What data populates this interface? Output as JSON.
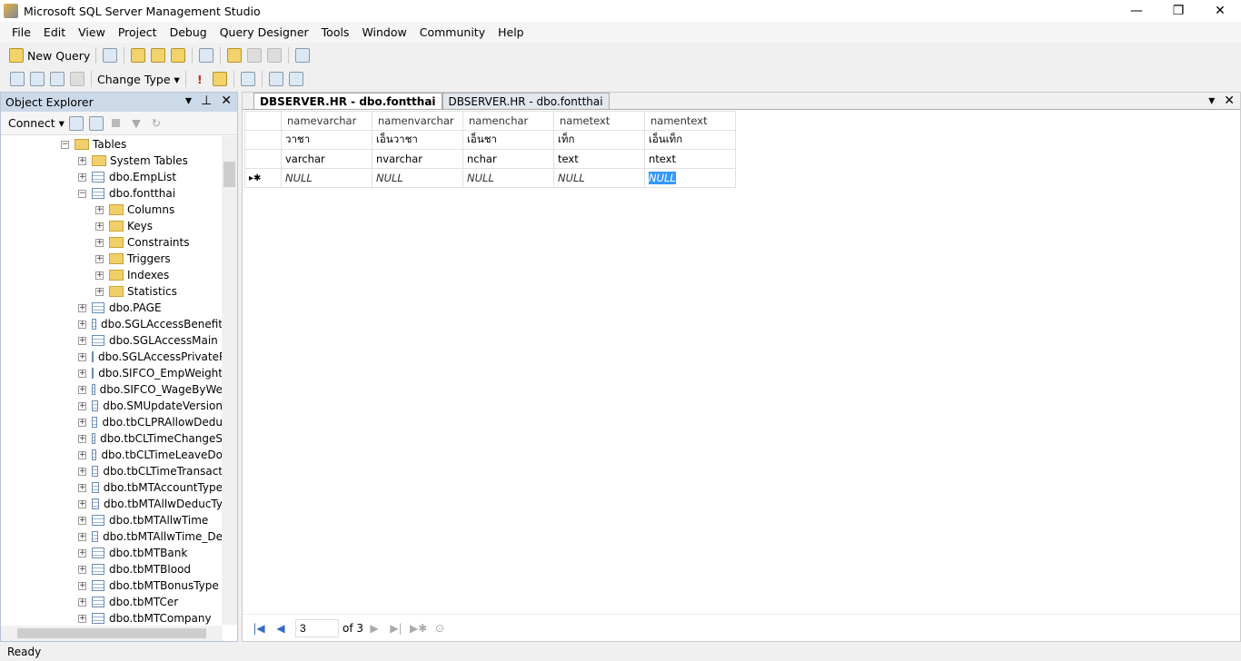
{
  "window": {
    "title": "Microsoft SQL Server Management Studio",
    "minimize": "—",
    "restore": "❐",
    "close": "✕"
  },
  "menu": [
    "File",
    "Edit",
    "View",
    "Project",
    "Debug",
    "Query Designer",
    "Tools",
    "Window",
    "Community",
    "Help"
  ],
  "toolbar": {
    "new_query": "New Query",
    "change_type": "Change Type ▾"
  },
  "object_explorer": {
    "title": "Object Explorer",
    "connect": "Connect ▾",
    "tree": [
      {
        "label": "Tables",
        "level": 0,
        "kind": "folder",
        "exp": "−"
      },
      {
        "label": "System Tables",
        "level": 1,
        "kind": "folder",
        "exp": "+"
      },
      {
        "label": "dbo.EmpList",
        "level": 1,
        "kind": "table",
        "exp": "+"
      },
      {
        "label": "dbo.fontthai",
        "level": 1,
        "kind": "table",
        "exp": "−"
      },
      {
        "label": "Columns",
        "level": 2,
        "kind": "folder",
        "exp": "+"
      },
      {
        "label": "Keys",
        "level": 2,
        "kind": "folder",
        "exp": "+"
      },
      {
        "label": "Constraints",
        "level": 2,
        "kind": "folder",
        "exp": "+"
      },
      {
        "label": "Triggers",
        "level": 2,
        "kind": "folder",
        "exp": "+"
      },
      {
        "label": "Indexes",
        "level": 2,
        "kind": "folder",
        "exp": "+"
      },
      {
        "label": "Statistics",
        "level": 2,
        "kind": "folder",
        "exp": "+"
      },
      {
        "label": "dbo.PAGE",
        "level": 1,
        "kind": "table",
        "exp": "+"
      },
      {
        "label": "dbo.SGLAccessBenefit",
        "level": 1,
        "kind": "table",
        "exp": "+"
      },
      {
        "label": "dbo.SGLAccessMain",
        "level": 1,
        "kind": "table",
        "exp": "+"
      },
      {
        "label": "dbo.SGLAccessPrivateR",
        "level": 1,
        "kind": "table",
        "exp": "+"
      },
      {
        "label": "dbo.SIFCO_EmpWeight",
        "level": 1,
        "kind": "table",
        "exp": "+"
      },
      {
        "label": "dbo.SIFCO_WageByWe",
        "level": 1,
        "kind": "table",
        "exp": "+"
      },
      {
        "label": "dbo.SMUpdateVersion",
        "level": 1,
        "kind": "table",
        "exp": "+"
      },
      {
        "label": "dbo.tbCLPRAllowDedu",
        "level": 1,
        "kind": "table",
        "exp": "+"
      },
      {
        "label": "dbo.tbCLTimeChangeS",
        "level": 1,
        "kind": "table",
        "exp": "+"
      },
      {
        "label": "dbo.tbCLTimeLeaveDo",
        "level": 1,
        "kind": "table",
        "exp": "+"
      },
      {
        "label": "dbo.tbCLTimeTransact",
        "level": 1,
        "kind": "table",
        "exp": "+"
      },
      {
        "label": "dbo.tbMTAccountType",
        "level": 1,
        "kind": "table",
        "exp": "+"
      },
      {
        "label": "dbo.tbMTAllwDeducTy",
        "level": 1,
        "kind": "table",
        "exp": "+"
      },
      {
        "label": "dbo.tbMTAllwTime",
        "level": 1,
        "kind": "table",
        "exp": "+"
      },
      {
        "label": "dbo.tbMTAllwTime_De",
        "level": 1,
        "kind": "table",
        "exp": "+"
      },
      {
        "label": "dbo.tbMTBank",
        "level": 1,
        "kind": "table",
        "exp": "+"
      },
      {
        "label": "dbo.tbMTBlood",
        "level": 1,
        "kind": "table",
        "exp": "+"
      },
      {
        "label": "dbo.tbMTBonusType",
        "level": 1,
        "kind": "table",
        "exp": "+"
      },
      {
        "label": "dbo.tbMTCer",
        "level": 1,
        "kind": "table",
        "exp": "+"
      },
      {
        "label": "dbo.tbMTCompany",
        "level": 1,
        "kind": "table",
        "exp": "+"
      }
    ]
  },
  "tabs": [
    "DBSERVER.HR - dbo.fontthai",
    "DBSERVER.HR - dbo.fontthai"
  ],
  "grid": {
    "columns": [
      "namevarchar",
      "namenvarchar",
      "namenchar",
      "nametext",
      "namentext"
    ],
    "rows": [
      {
        "marker": "",
        "cells": [
          "วาชา",
          "เอ็นวาชา",
          "เอ็นชา",
          "เท็ก",
          "เอ็นเท็ก"
        ]
      },
      {
        "marker": "",
        "cells": [
          "varchar",
          "nvarchar",
          "nchar",
          "text",
          "ntext"
        ]
      },
      {
        "marker": "▸✱",
        "cells": [
          "NULL",
          "NULL",
          "NULL",
          "NULL",
          "NULL"
        ]
      }
    ]
  },
  "pager": {
    "current": "3",
    "of": "of 3"
  },
  "status": "Ready"
}
